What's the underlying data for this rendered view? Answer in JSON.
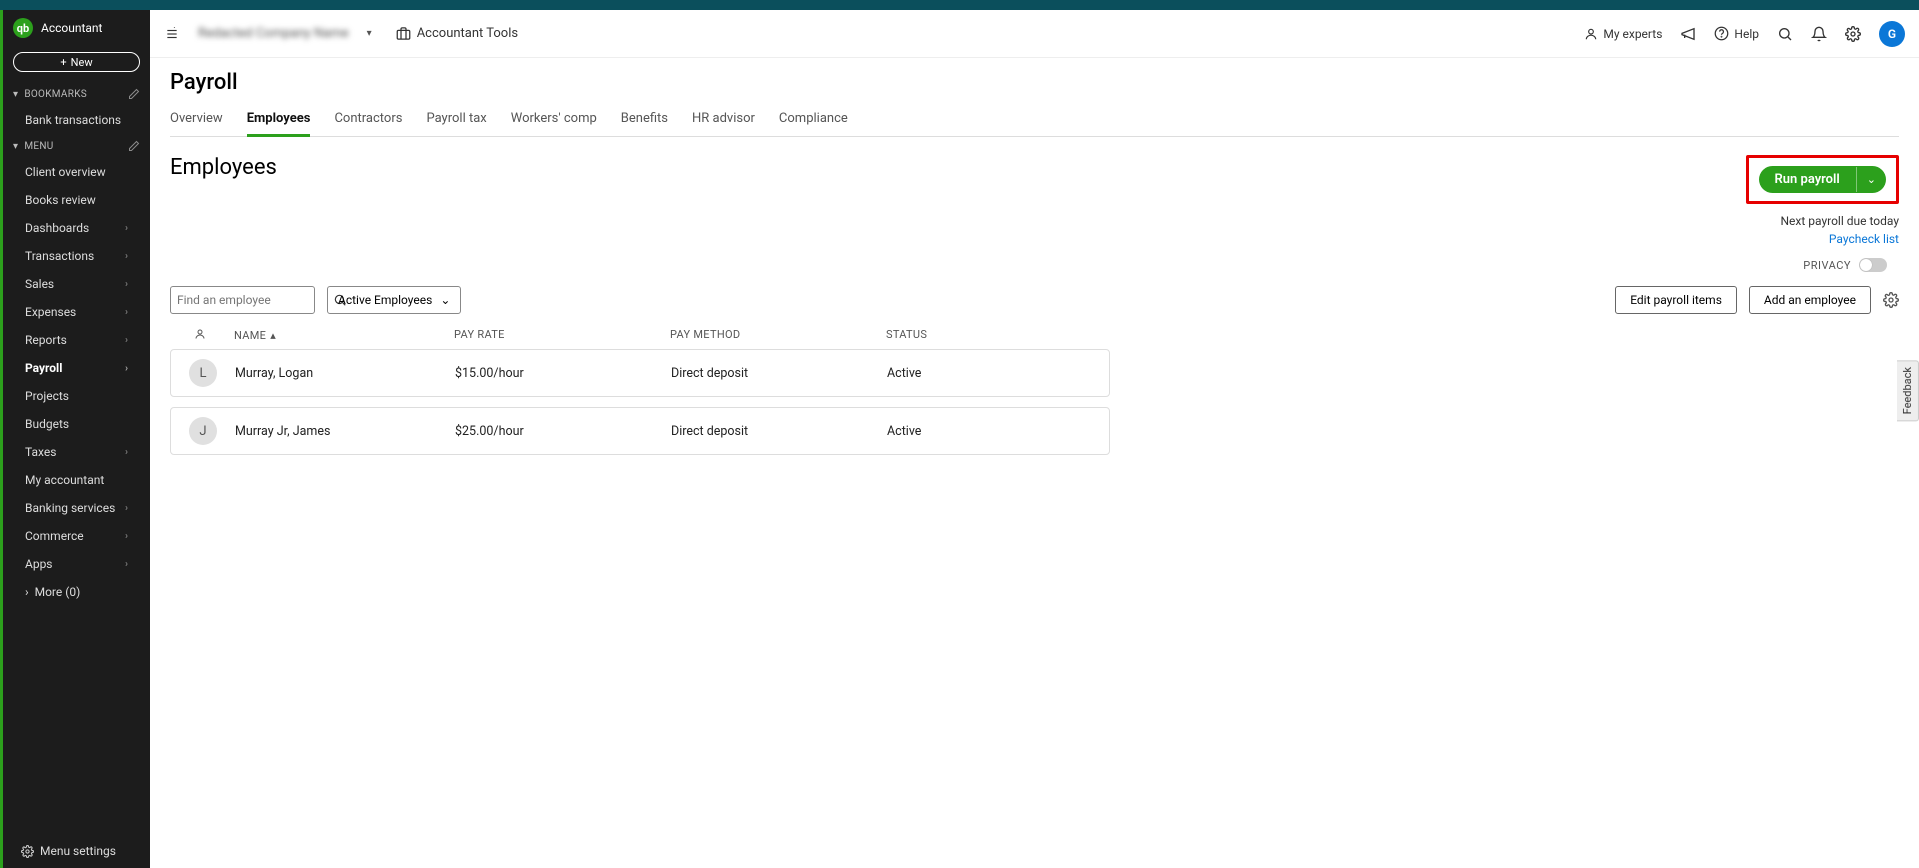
{
  "brand": "Accountant",
  "new_button": "New",
  "sidebar": {
    "bookmarks_label": "BOOKMARKS",
    "bookmarks": [
      "Bank transactions"
    ],
    "menu_label": "MENU",
    "items": [
      {
        "label": "Client overview",
        "chev": false
      },
      {
        "label": "Books review",
        "chev": false
      },
      {
        "label": "Dashboards",
        "chev": true
      },
      {
        "label": "Transactions",
        "chev": true
      },
      {
        "label": "Sales",
        "chev": true
      },
      {
        "label": "Expenses",
        "chev": true
      },
      {
        "label": "Reports",
        "chev": true
      },
      {
        "label": "Payroll",
        "chev": true,
        "active": true
      },
      {
        "label": "Projects",
        "chev": false
      },
      {
        "label": "Budgets",
        "chev": false
      },
      {
        "label": "Taxes",
        "chev": true
      },
      {
        "label": "My accountant",
        "chev": false
      },
      {
        "label": "Banking services",
        "chev": true
      },
      {
        "label": "Commerce",
        "chev": true
      },
      {
        "label": "Apps",
        "chev": true
      }
    ],
    "more": "More (0)",
    "settings": "Menu settings"
  },
  "topnav": {
    "company": "Redacted Company Name",
    "tools": "Accountant Tools",
    "experts": "My experts",
    "help": "Help",
    "avatar": "G"
  },
  "page": {
    "title": "Payroll",
    "tabs": [
      "Overview",
      "Employees",
      "Contractors",
      "Payroll tax",
      "Workers' comp",
      "Benefits",
      "HR advisor",
      "Compliance"
    ],
    "active_tab": 1,
    "subtitle": "Employees",
    "run_payroll": "Run payroll",
    "next_due": "Next payroll due today",
    "paycheck_list": "Paycheck list",
    "privacy": "PRIVACY",
    "search_placeholder": "Find an employee",
    "filter": "Active Employees",
    "edit_items": "Edit payroll items",
    "add_employee": "Add an employee",
    "columns": {
      "name": "NAME",
      "pay_rate": "PAY RATE",
      "pay_method": "PAY METHOD",
      "status": "STATUS"
    },
    "rows": [
      {
        "initial": "L",
        "name": "Murray, Logan",
        "rate": "$15.00/hour",
        "method": "Direct deposit",
        "status": "Active"
      },
      {
        "initial": "J",
        "name": "Murray Jr, James",
        "rate": "$25.00/hour",
        "method": "Direct deposit",
        "status": "Active"
      }
    ]
  },
  "feedback": "Feedback"
}
